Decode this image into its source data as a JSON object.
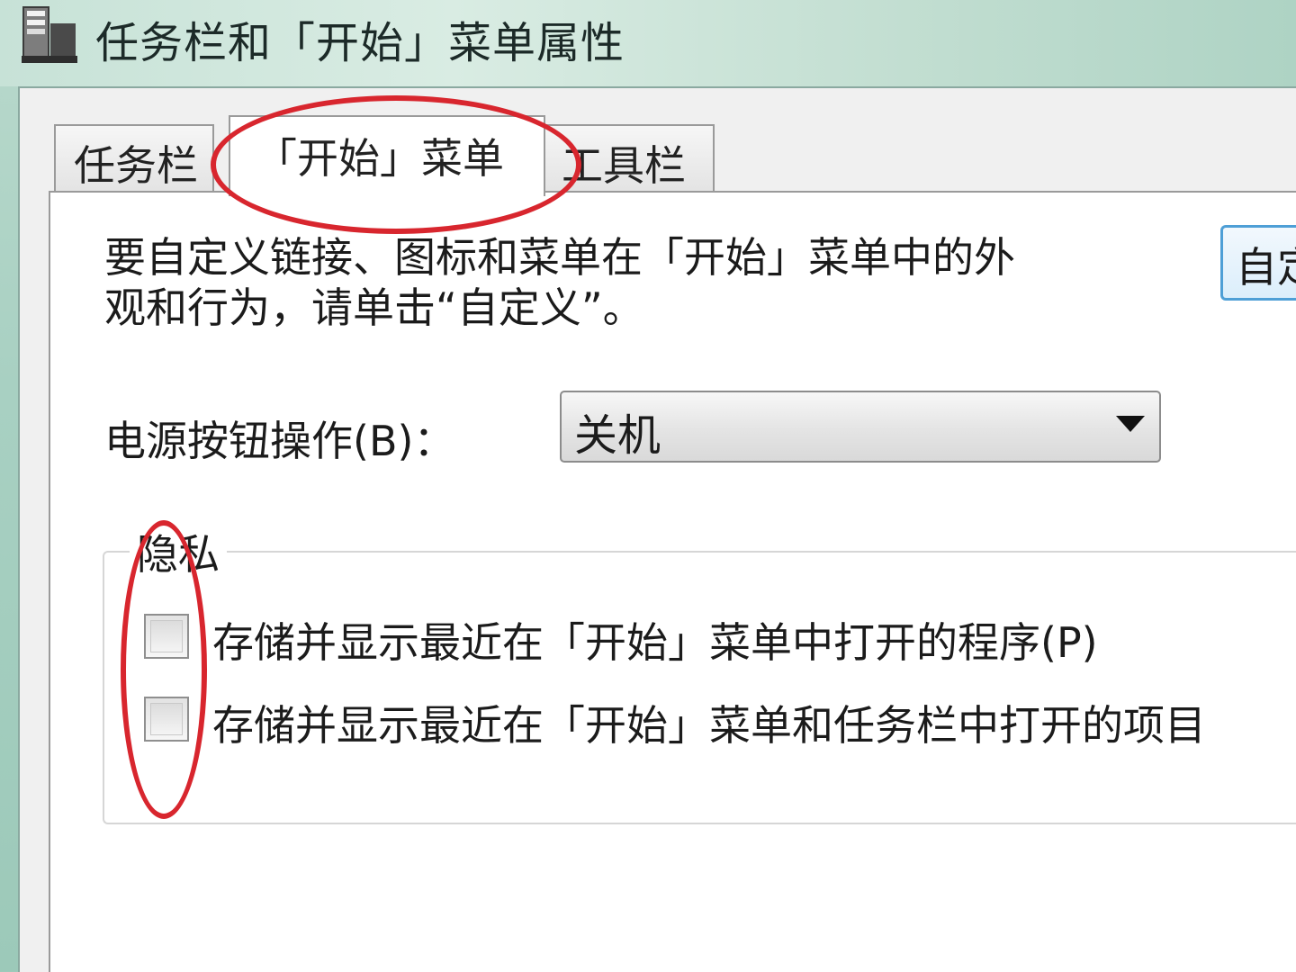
{
  "window": {
    "title": "任务栏和「开始」菜单属性",
    "icon": "taskbar-properties-icon"
  },
  "tabs": [
    {
      "label": "任务栏",
      "active": false
    },
    {
      "label": "「开始」菜单",
      "active": true
    },
    {
      "label": "工具栏",
      "active": false
    }
  ],
  "panel": {
    "description_line1": "要自定义链接、图标和菜单在「开始」菜单中的外",
    "description_line2": "观和行为，请单击“自定义”。",
    "customize_button_label": "自定",
    "power_button": {
      "label": "电源按钮操作(B)：",
      "selected": "关机"
    },
    "privacy": {
      "legend": "隐私",
      "items": [
        {
          "label": "存储并显示最近在「开始」菜单中打开的程序(P)",
          "checked": false
        },
        {
          "label": "存储并显示最近在「开始」菜单和任务栏中打开的项目",
          "checked": false
        }
      ]
    }
  },
  "colors": {
    "annotation": "#d8262e",
    "button_border": "#4e9fd6"
  }
}
